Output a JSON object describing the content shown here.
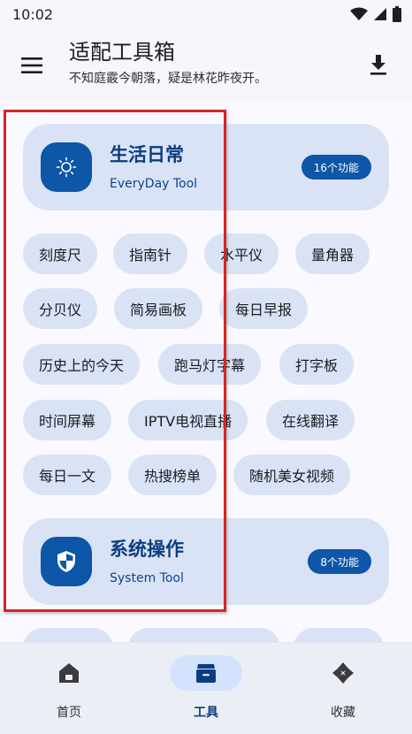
{
  "status_bar": {
    "time": "10:02"
  },
  "header": {
    "title": "适配工具箱",
    "subtitle": "不知庭霰今朝落，疑是林花昨夜开。"
  },
  "categories": [
    {
      "title": "生活日常",
      "subtitle": "EveryDay Tool",
      "badge": "16个功能",
      "icon": "sun-icon"
    },
    {
      "title": "系统操作",
      "subtitle": "System Tool",
      "badge": "8个功能",
      "icon": "shield-icon"
    }
  ],
  "tools": [
    "刻度尺",
    "指南针",
    "水平仪",
    "量角器",
    "分贝仪",
    "简易画板",
    "每日早报",
    "历史上的今天",
    "跑马灯字幕",
    "打字板",
    "时间屏幕",
    "IPTV电视直播",
    "在线翻译",
    "每日一文",
    "热搜榜单",
    "随机美女视频"
  ],
  "bottom_nav": [
    {
      "label": "首页",
      "icon": "home-icon",
      "active": false
    },
    {
      "label": "工具",
      "icon": "toolbox-icon",
      "active": true
    },
    {
      "label": "收藏",
      "icon": "collection-icon",
      "active": false
    }
  ],
  "colors": {
    "accent": "#0d56a8",
    "card": "#d9e3f5",
    "highlight": "#d42626"
  }
}
